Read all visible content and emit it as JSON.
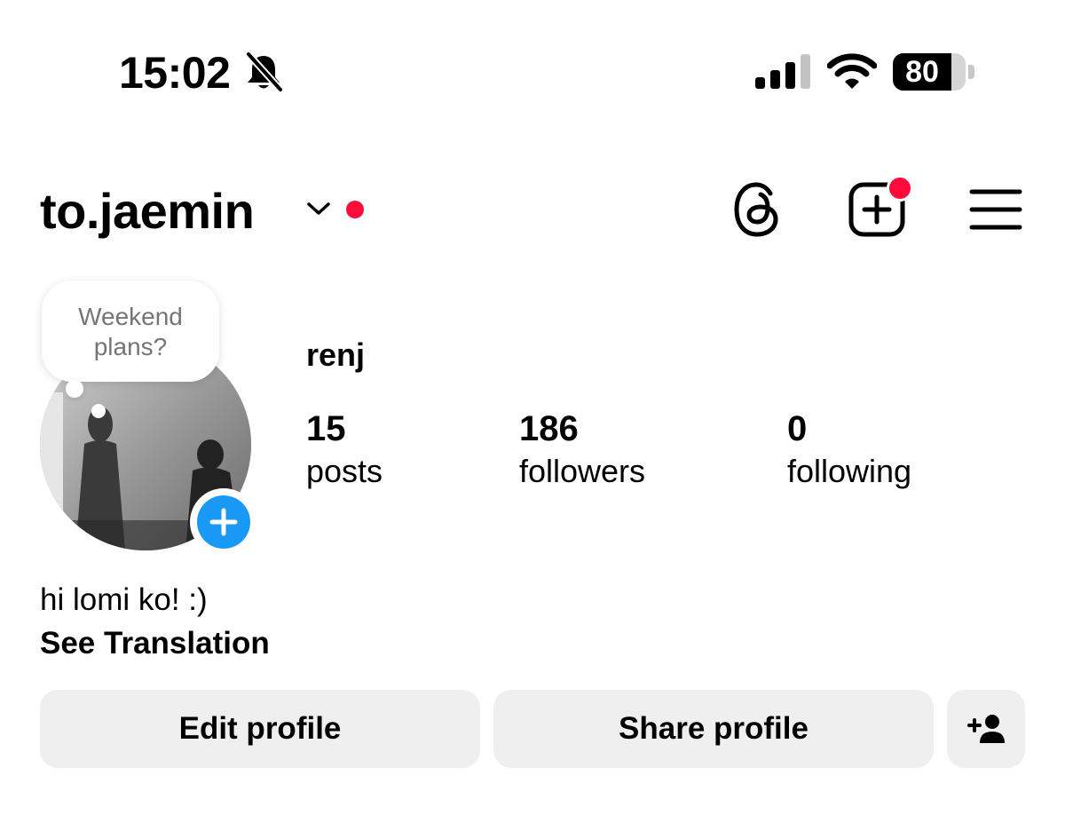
{
  "status_bar": {
    "time": "15:02",
    "battery_level": 80,
    "battery_text": "80",
    "icons": [
      "bell-slash-icon",
      "cellular-signal-icon",
      "wifi-icon",
      "battery-icon"
    ]
  },
  "header": {
    "username": "to.jaemin",
    "icons": [
      "chevron-down-icon",
      "notification-dot",
      "threads-icon",
      "create-post-icon",
      "menu-icon"
    ],
    "notification_dot_color": "#ff0a3a"
  },
  "profile": {
    "note_line1": "Weekend",
    "note_line2": "plans?",
    "display_name": "renj",
    "stats": {
      "posts_value": "15",
      "posts_label": "posts",
      "followers_value": "186",
      "followers_label": "followers",
      "following_value": "0",
      "following_label": "following"
    },
    "bio": "hi lomi ko! :)",
    "see_translation": "See Translation",
    "add_story_color": "#1a98f5"
  },
  "actions": {
    "edit_profile": "Edit profile",
    "share_profile": "Share profile",
    "add_person_icon": "add-person-icon"
  }
}
